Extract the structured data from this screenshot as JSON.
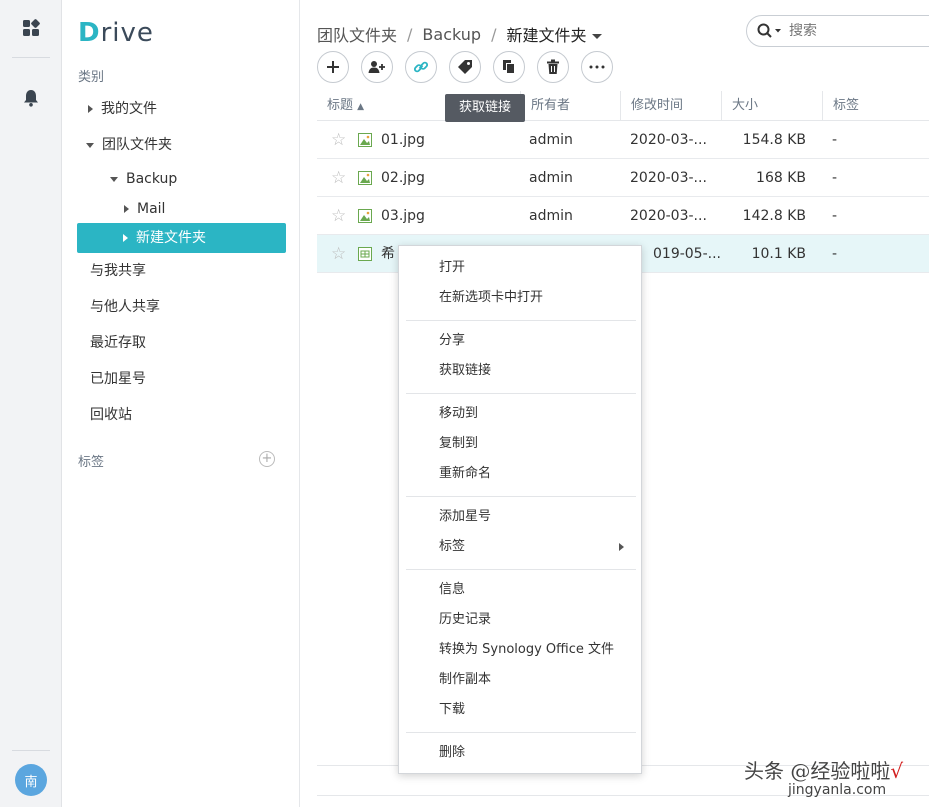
{
  "app": {
    "logo_initial": "D",
    "logo_rest": "rive"
  },
  "rail": {
    "apps_icon": "apps-grid-icon",
    "bell_icon": "bell-icon",
    "avatar_text": "南"
  },
  "sidebar": {
    "category_label": "类别",
    "items": [
      {
        "label": "我的文件"
      },
      {
        "label": "团队文件夹"
      },
      {
        "label": "Backup"
      },
      {
        "label": "Mail"
      },
      {
        "label": "新建文件夹"
      },
      {
        "label": "与我共享"
      },
      {
        "label": "与他人共享"
      },
      {
        "label": "最近存取"
      },
      {
        "label": "已加星号"
      },
      {
        "label": "回收站"
      }
    ],
    "tags_label": "标签",
    "add_tag_icon": "plus-circle-icon"
  },
  "breadcrumb": {
    "root": "团队文件夹",
    "sep": "/",
    "mid": "Backup",
    "current": "新建文件夹"
  },
  "search": {
    "placeholder": "搜索"
  },
  "toolbar": {
    "buttons": [
      "plus-icon",
      "add-user-icon",
      "link-icon",
      "tag-icon",
      "copy-icon",
      "trash-icon",
      "more-icon"
    ],
    "tooltip": "获取链接"
  },
  "table": {
    "headers": [
      "标题",
      "所有者",
      "修改时间",
      "大小",
      "标签"
    ],
    "rows": [
      {
        "name": "01.jpg",
        "owner": "admin",
        "modified": "2020-03-...",
        "size": "154.8 KB",
        "tags": "-"
      },
      {
        "name": "02.jpg",
        "owner": "admin",
        "modified": "2020-03-...",
        "size": "168 KB",
        "tags": "-"
      },
      {
        "name": "03.jpg",
        "owner": "admin",
        "modified": "2020-03-...",
        "size": "142.8 KB",
        "tags": "-"
      },
      {
        "name": "希",
        "owner": "",
        "modified": "019-05-...",
        "size": "10.1 KB",
        "tags": "-"
      }
    ]
  },
  "context_menu": {
    "items": [
      "打开",
      "在新选项卡中打开",
      "分享",
      "获取链接",
      "移动到",
      "复制到",
      "重新命名",
      "添加星号",
      "标签",
      "信息",
      "历史记录",
      "转换为 Synology Office 文件",
      "制作副本",
      "下载",
      "删除"
    ]
  },
  "watermark": {
    "line1": "头条 @经验啦啦",
    "check": "√",
    "line2": "jingyanla.com"
  }
}
